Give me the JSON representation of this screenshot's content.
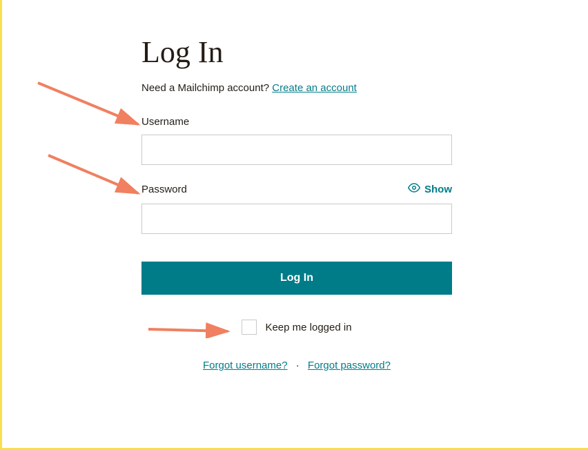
{
  "page": {
    "title": "Log In",
    "sub_text": "Need a Mailchimp account? ",
    "create_account_link": "Create an account"
  },
  "form": {
    "username_label": "Username",
    "password_label": "Password",
    "show_label": "Show",
    "login_button": "Log In",
    "keep_logged_in_label": "Keep me logged in",
    "username_value": "",
    "password_value": ""
  },
  "links": {
    "forgot_username": "Forgot username?",
    "forgot_password": "Forgot password?"
  },
  "colors": {
    "accent": "#007c89",
    "text": "#241c15",
    "border": "#c9c9c9",
    "annotation_arrow": "#f08060"
  },
  "annotations": [
    {
      "target": "username-label",
      "points_to": "Username"
    },
    {
      "target": "password-label",
      "points_to": "Password"
    },
    {
      "target": "keep-checkbox",
      "points_to": "Keep me logged in"
    }
  ]
}
